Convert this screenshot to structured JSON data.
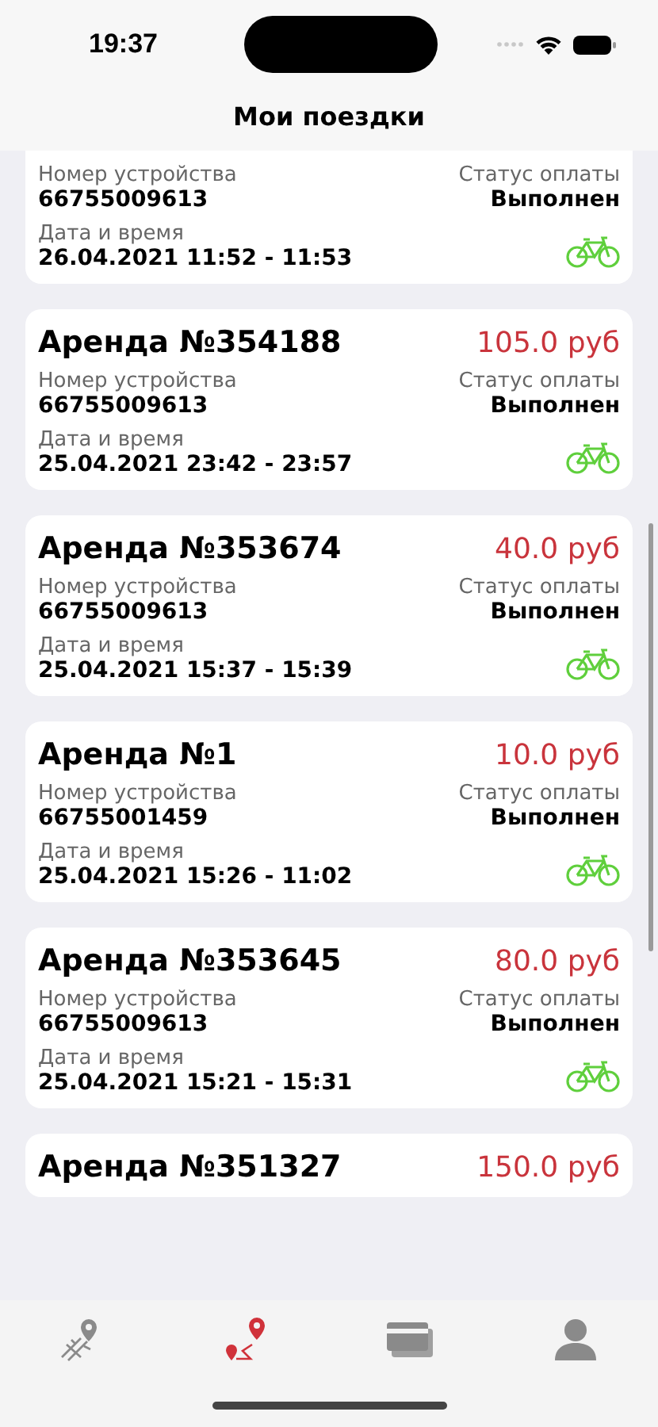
{
  "status_bar": {
    "time": "19:37"
  },
  "title": "Мои поездки",
  "rentals": [
    {
      "device_label": "Номер устройства",
      "device": "66755009613",
      "status_label": "Статус оплаты",
      "status": "Выполнен",
      "date_label": "Дата и время",
      "date": "26.04.2021 11:52 - 11:53"
    },
    {
      "title": "Аренда №354188",
      "price": "105.0 руб",
      "device_label": "Номер устройства",
      "device": "66755009613",
      "status_label": "Статус оплаты",
      "status": "Выполнен",
      "date_label": "Дата и время",
      "date": "25.04.2021 23:42 - 23:57"
    },
    {
      "title": "Аренда №353674",
      "price": "40.0 руб",
      "device_label": "Номер устройства",
      "device": "66755009613",
      "status_label": "Статус оплаты",
      "status": "Выполнен",
      "date_label": "Дата и время",
      "date": "25.04.2021 15:37 - 15:39"
    },
    {
      "title": "Аренда №1",
      "price": "10.0 руб",
      "device_label": "Номер устройства",
      "device": "66755001459",
      "status_label": "Статус оплаты",
      "status": "Выполнен",
      "date_label": "Дата и время",
      "date": "25.04.2021 15:26 - 11:02"
    },
    {
      "title": "Аренда №353645",
      "price": "80.0 руб",
      "device_label": "Номер устройства",
      "device": "66755009613",
      "status_label": "Статус оплаты",
      "status": "Выполнен",
      "date_label": "Дата и время",
      "date": "25.04.2021 15:21 - 15:31"
    },
    {
      "title": "Аренда №351327",
      "price": "150.0 руб"
    }
  ],
  "tabs": [
    {
      "kind": "map",
      "selected": false
    },
    {
      "kind": "route",
      "selected": true
    },
    {
      "kind": "cards",
      "selected": false
    },
    {
      "kind": "profile",
      "selected": false
    }
  ]
}
